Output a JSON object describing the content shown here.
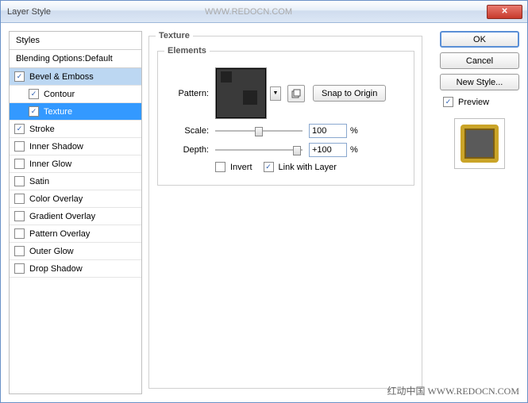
{
  "window": {
    "title": "Layer Style",
    "watermark": "WWW.REDOCN.COM"
  },
  "styles": {
    "header": "Styles",
    "blending": "Blending Options:Default",
    "items": [
      {
        "label": "Bevel & Emboss",
        "checked": true,
        "selected": "light",
        "indent": false
      },
      {
        "label": "Contour",
        "checked": true,
        "selected": false,
        "indent": true
      },
      {
        "label": "Texture",
        "checked": true,
        "selected": true,
        "indent": true
      },
      {
        "label": "Stroke",
        "checked": true,
        "selected": false,
        "indent": false
      },
      {
        "label": "Inner Shadow",
        "checked": false,
        "selected": false,
        "indent": false
      },
      {
        "label": "Inner Glow",
        "checked": false,
        "selected": false,
        "indent": false
      },
      {
        "label": "Satin",
        "checked": false,
        "selected": false,
        "indent": false
      },
      {
        "label": "Color Overlay",
        "checked": false,
        "selected": false,
        "indent": false
      },
      {
        "label": "Gradient Overlay",
        "checked": false,
        "selected": false,
        "indent": false
      },
      {
        "label": "Pattern Overlay",
        "checked": false,
        "selected": false,
        "indent": false
      },
      {
        "label": "Outer Glow",
        "checked": false,
        "selected": false,
        "indent": false
      },
      {
        "label": "Drop Shadow",
        "checked": false,
        "selected": false,
        "indent": false
      }
    ]
  },
  "texture": {
    "title": "Texture",
    "elements_title": "Elements",
    "pattern_label": "Pattern:",
    "snap_label": "Snap to Origin",
    "scale_label": "Scale:",
    "scale_value": "100",
    "scale_unit": "%",
    "depth_label": "Depth:",
    "depth_value": "+100",
    "depth_unit": "%",
    "invert_label": "Invert",
    "invert_checked": false,
    "link_label": "Link with Layer",
    "link_checked": true
  },
  "buttons": {
    "ok": "OK",
    "cancel": "Cancel",
    "new_style": "New Style...",
    "preview_label": "Preview",
    "preview_checked": true
  },
  "footer": "红动中国 WWW.REDOCN.COM"
}
